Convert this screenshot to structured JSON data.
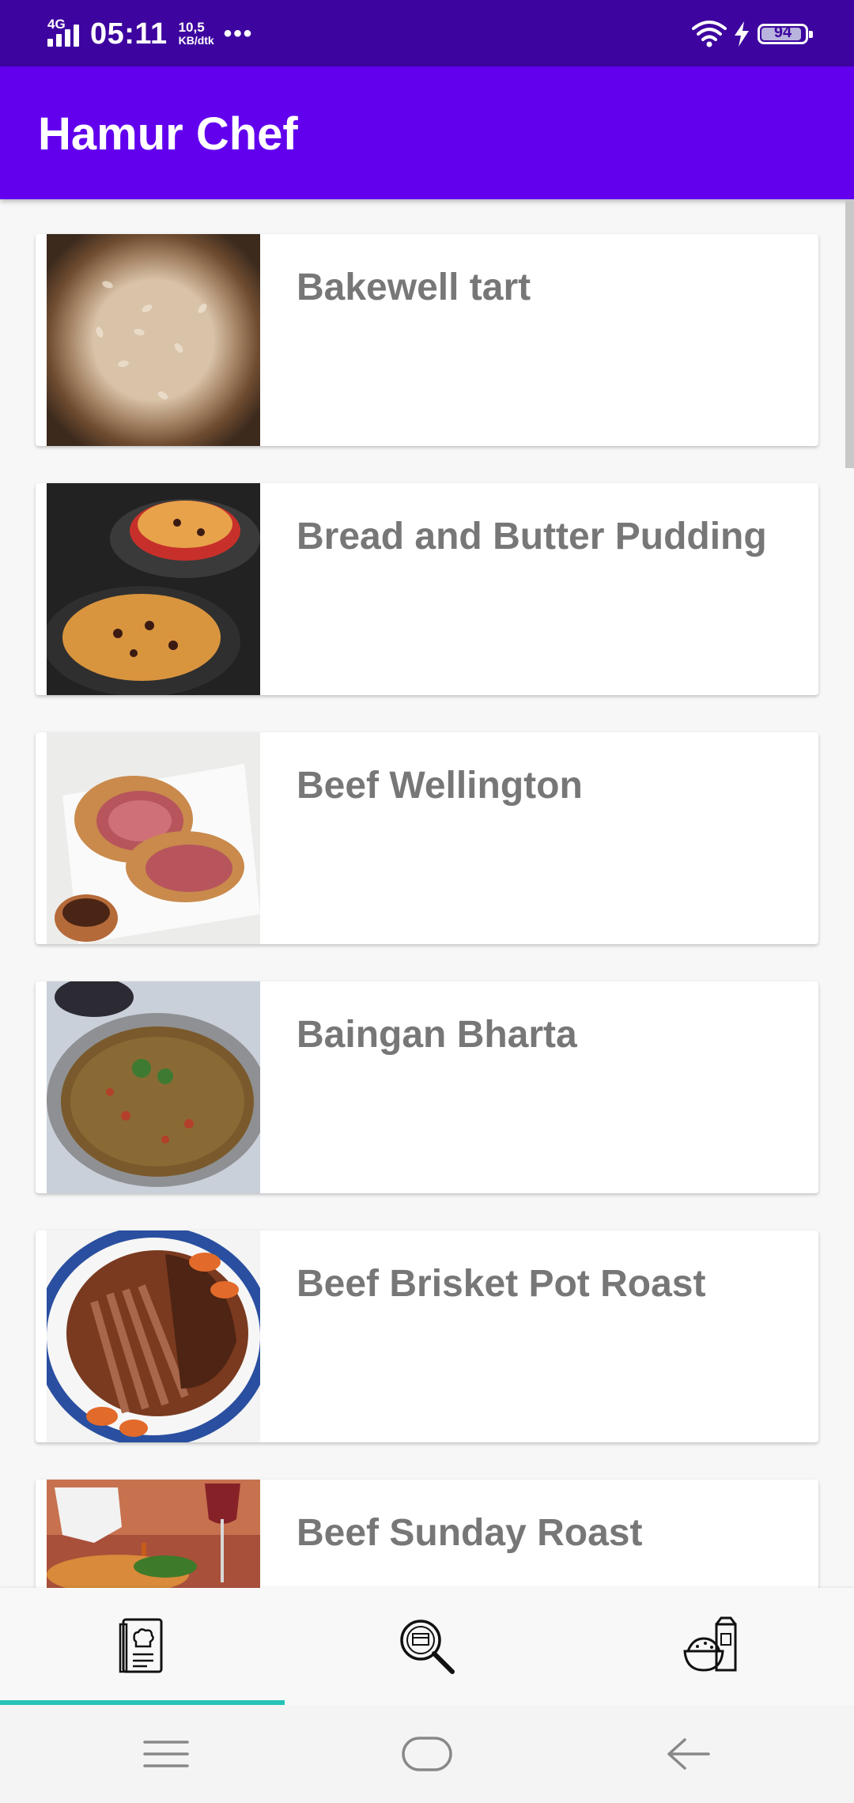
{
  "status_bar": {
    "network": "4G",
    "time": "05:11",
    "speed_value": "10,5",
    "speed_unit": "KB/dtk",
    "more": "•••",
    "battery_level": "94",
    "icons": [
      "signal-icon",
      "wifi-icon",
      "charging-icon",
      "battery-icon"
    ]
  },
  "app_bar": {
    "title": "Hamur Chef"
  },
  "recipes": [
    {
      "title": "Bakewell tart",
      "image": "bakewell-tart-image"
    },
    {
      "title": "Bread and Butter Pudding",
      "image": "bread-butter-pudding-image"
    },
    {
      "title": "Beef Wellington",
      "image": "beef-wellington-image"
    },
    {
      "title": "Baingan Bharta",
      "image": "baingan-bharta-image"
    },
    {
      "title": "Beef Brisket Pot Roast",
      "image": "beef-brisket-image"
    },
    {
      "title": "Beef Sunday Roast",
      "image": "beef-sunday-roast-image"
    }
  ],
  "bottom_nav": {
    "items": [
      {
        "icon": "recipe-book-icon",
        "selected": true
      },
      {
        "icon": "search-menu-icon",
        "selected": false
      },
      {
        "icon": "ingredients-icon",
        "selected": false
      }
    ],
    "indicator_color": "#25c3b8"
  },
  "system_nav": {
    "icons": [
      "menu-icon",
      "home-icon",
      "back-icon"
    ]
  },
  "colors": {
    "status_bar": "#3d049f",
    "app_bar": "#6200ee",
    "title_text": "#777777"
  }
}
